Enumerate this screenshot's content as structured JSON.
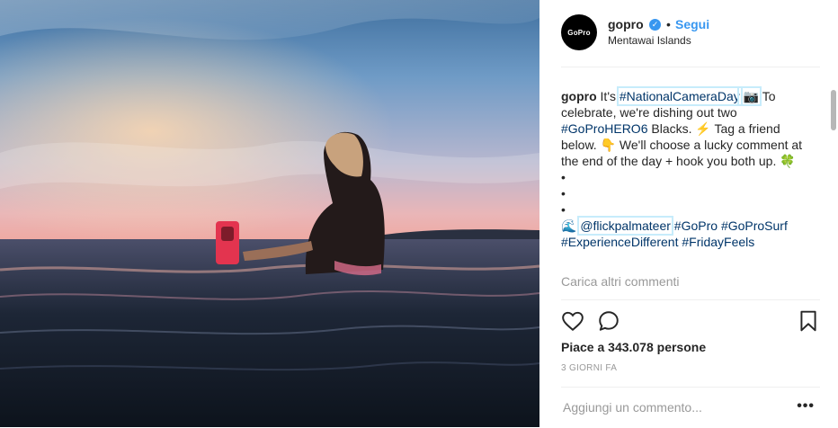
{
  "post": {
    "username": "gopro",
    "avatar_text": "GoPro",
    "verified_icon": "verified-badge-icon",
    "separator": "•",
    "follow_label": "Segui",
    "location": "Mentawai Islands"
  },
  "caption": {
    "username": "gopro",
    "text_1": " It's ",
    "tag_1": "#NationalCameraDay",
    "emoji_camera": " 📷",
    "text_2": " To celebrate, we're dishing out two ",
    "tag_2": "#GoProHERO6",
    "text_3": " Blacks. ⚡ Tag a friend below. 👇 We'll choose a lucky comment at the end of the day + hook you both up. 🍀",
    "bullet": "•",
    "emoji_wave": "🌊 ",
    "mention": "@flickpalmateer",
    "tag_3": "#GoPro",
    "tag_4": "#GoProSurf",
    "tag_5": "#ExperienceDifferent",
    "tag_6": "#FridayFeels"
  },
  "load_more": "Carica altri commenti",
  "likes": "Piace a 343.078 persone",
  "timestamp": "3 GIORNI FA",
  "comment_box": {
    "placeholder": "Aggiungi un commento...",
    "more": "•••"
  },
  "colors": {
    "link": "#003569",
    "accent": "#3897f0",
    "muted": "#999999",
    "highlight": "#c7ecfb"
  }
}
